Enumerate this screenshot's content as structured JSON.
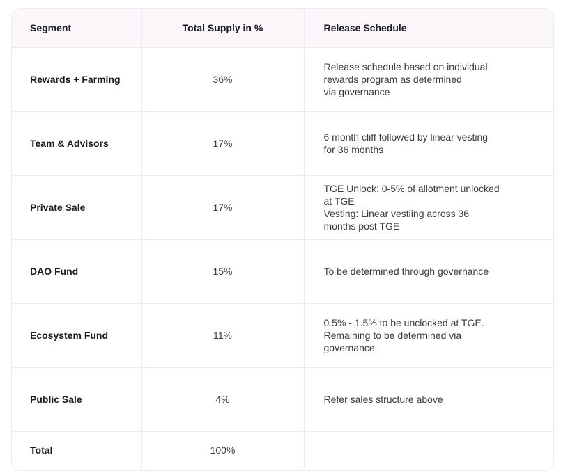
{
  "table": {
    "headers": {
      "segment": "Segment",
      "supply": "Total Supply in %",
      "release": "Release Schedule"
    },
    "rows": [
      {
        "segment": "Rewards + Farming",
        "supply": "36%",
        "release": [
          "Release schedule based on individual",
          "rewards program as determined",
          "via governance"
        ]
      },
      {
        "segment": "Team & Advisors",
        "supply": "17%",
        "release": [
          "6 month cliff followed by linear vesting",
          "for 36 months"
        ]
      },
      {
        "segment": "Private Sale",
        "supply": "17%",
        "release": [
          "TGE Unlock: 0-5% of allotment unlocked",
          "at TGE",
          "Vesting: Linear vestiing across 36",
          "months post TGE"
        ]
      },
      {
        "segment": "DAO Fund",
        "supply": "15%",
        "release": [
          "To be determined through governance"
        ]
      },
      {
        "segment": "Ecosystem Fund",
        "supply": "11%",
        "release": [
          "0.5% - 1.5% to be unclocked at TGE.",
          "Remaining to be determined via",
          "governance."
        ]
      },
      {
        "segment": "Public Sale",
        "supply": "4%",
        "release": [
          "Refer sales structure above"
        ]
      }
    ],
    "total": {
      "segment": "Total",
      "supply": "100%",
      "release": ""
    }
  }
}
